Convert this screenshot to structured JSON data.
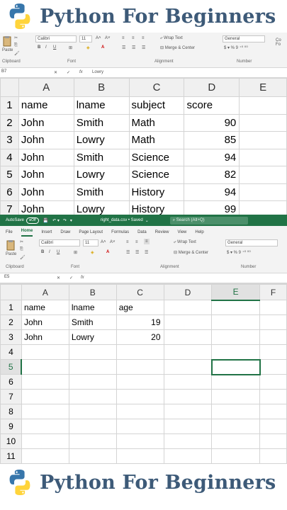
{
  "banner": {
    "title": "Python For Beginners"
  },
  "top_excel": {
    "ribbon": {
      "paste_label": "Paste",
      "font_name": "Calibri",
      "font_size": "11",
      "wrap_text": "Wrap Text",
      "merge_center": "Merge & Center",
      "number_format": "General",
      "group_clipboard": "Clipboard",
      "group_font": "Font",
      "group_alignment": "Alignment",
      "group_number": "Number",
      "conditional_format": "Co\nFo"
    },
    "name_box": "B7",
    "fx": "fx",
    "formula_value": "Lowry",
    "columns": [
      "",
      "A",
      "B",
      "C",
      "D",
      "E"
    ],
    "rows": [
      {
        "n": "1",
        "a": "name",
        "b": "lname",
        "c": "subject",
        "d": "score"
      },
      {
        "n": "2",
        "a": "John",
        "b": "Smith",
        "c": "Math",
        "d": "90"
      },
      {
        "n": "3",
        "a": "John",
        "b": "Lowry",
        "c": "Math",
        "d": "85"
      },
      {
        "n": "4",
        "a": "John",
        "b": "Smith",
        "c": "Science",
        "d": "94"
      },
      {
        "n": "5",
        "a": "John",
        "b": "Lowry",
        "c": "Science",
        "d": "82"
      },
      {
        "n": "6",
        "a": "John",
        "b": "Smith",
        "c": "History",
        "d": "94"
      },
      {
        "n": "7",
        "a": "John",
        "b": "Lowry",
        "c": "History",
        "d": "99"
      }
    ]
  },
  "bottom_excel": {
    "autosave_label": "AutoSave",
    "autosave_state": "Off",
    "file_title": "right_data.csv • Saved",
    "search_placeholder": "Search (Alt+Q)",
    "tabs": [
      "File",
      "Home",
      "Insert",
      "Draw",
      "Page Layout",
      "Formulas",
      "Data",
      "Review",
      "View",
      "Help"
    ],
    "active_tab": "Home",
    "ribbon": {
      "paste_label": "Paste",
      "font_name": "Calibri",
      "font_size": "11",
      "wrap_text": "Wrap Text",
      "merge_center": "Merge & Center",
      "number_format": "General",
      "group_clipboard": "Clipboard",
      "group_font": "Font",
      "group_alignment": "Alignment",
      "group_number": "Number"
    },
    "name_box": "E5",
    "fx": "fx",
    "formula_value": "",
    "columns": [
      "",
      "A",
      "B",
      "C",
      "D",
      "E",
      "F"
    ],
    "rows": [
      {
        "n": "1",
        "a": "name",
        "b": "lname",
        "c": "age"
      },
      {
        "n": "2",
        "a": "John",
        "b": "Smith",
        "c": "19"
      },
      {
        "n": "3",
        "a": "John",
        "b": "Lowry",
        "c": "20"
      },
      {
        "n": "4",
        "a": "",
        "b": "",
        "c": ""
      },
      {
        "n": "5",
        "a": "",
        "b": "",
        "c": ""
      },
      {
        "n": "6",
        "a": "",
        "b": "",
        "c": ""
      },
      {
        "n": "7",
        "a": "",
        "b": "",
        "c": ""
      },
      {
        "n": "8",
        "a": "",
        "b": "",
        "c": ""
      },
      {
        "n": "9",
        "a": "",
        "b": "",
        "c": ""
      },
      {
        "n": "10",
        "a": "",
        "b": "",
        "c": ""
      },
      {
        "n": "11",
        "a": "",
        "b": "",
        "c": ""
      }
    ]
  },
  "colors": {
    "brand_title": "#3d5a78",
    "excel_green": "#217346"
  }
}
